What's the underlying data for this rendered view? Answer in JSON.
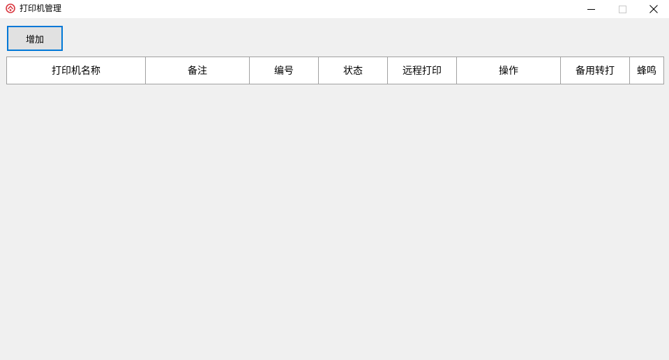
{
  "window": {
    "title": "打印机管理",
    "icon": "printer-app-icon",
    "controls": {
      "minimize": "minimize-icon",
      "maximize": "maximize-icon",
      "close": "close-icon"
    }
  },
  "toolbar": {
    "add_label": "增加"
  },
  "table": {
    "columns": [
      "打印机名称",
      "备注",
      "编号",
      "状态",
      "远程打印",
      "操作",
      "备用转打",
      "蜂鸣"
    ],
    "rows": []
  },
  "colors": {
    "background": "#f0f0f0",
    "titlebar": "#ffffff",
    "accent": "#0078d7",
    "button_face": "#e1e1e1",
    "table_border": "#a0a0a0",
    "icon_red": "#d9363e"
  }
}
